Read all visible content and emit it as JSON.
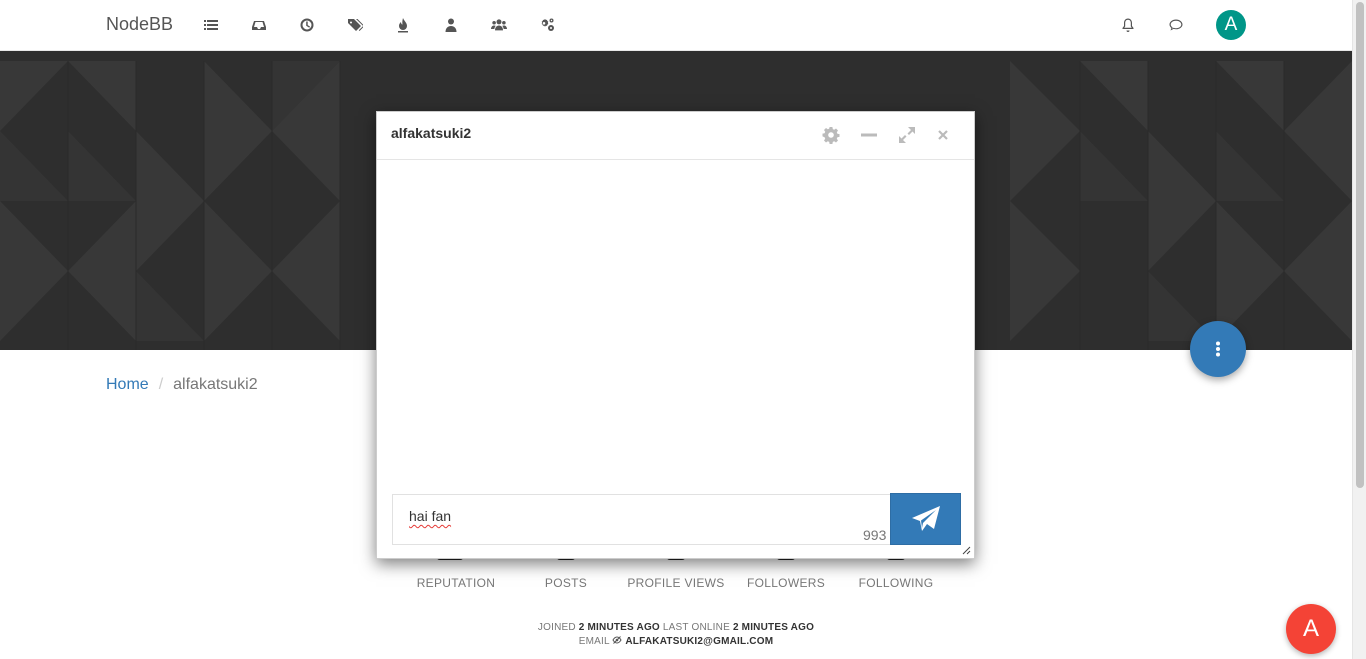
{
  "navbar": {
    "brand": "NodeBB",
    "icons": [
      "categories-icon",
      "unread-icon",
      "recent-icon",
      "tags-icon",
      "popular-icon",
      "users-icon",
      "groups-icon",
      "admin-icon"
    ],
    "avatar_letter": "A",
    "avatar_color": "#009688"
  },
  "breadcrumb": {
    "home": "Home",
    "separator": "/",
    "current": "alfakatsuki2"
  },
  "stats": [
    "REPUTATION",
    "POSTS",
    "PROFILE VIEWS",
    "FOLLOWERS",
    "FOLLOWING"
  ],
  "profile_meta": {
    "joined_label": "JOINED",
    "joined_value": "2 MINUTES AGO",
    "last_online_label": "LAST ONLINE",
    "last_online_value": "2 MINUTES AGO",
    "email_label": "EMAIL",
    "email_value": "ALFAKATSUKI2@GMAIL.COM"
  },
  "chat": {
    "title": "alfakatsuki2",
    "message": "hai fan",
    "char_count": "993"
  },
  "fab_avatar": {
    "letter": "A",
    "color": "#f44336"
  },
  "colors": {
    "accent": "#337ab7",
    "cover": "#2e2e2e"
  }
}
